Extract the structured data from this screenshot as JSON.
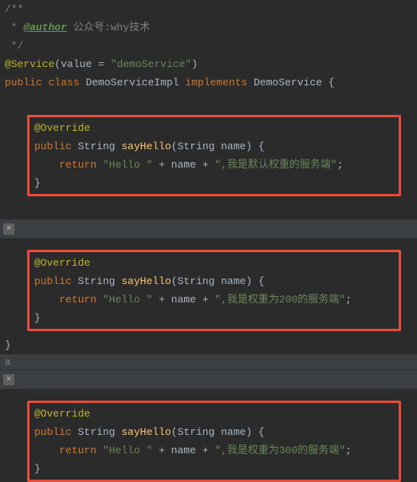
{
  "header": {
    "comment_open": "/**",
    "author_tag": "@author",
    "author_text": " 公众号:why技术",
    "comment_mid": " * ",
    "comment_close": " */"
  },
  "class_decl": {
    "annotation": "@Service",
    "anno_attr": "value",
    "anno_eq": " = ",
    "anno_val": "\"demoService\"",
    "kw_public": "public",
    "kw_class": "class",
    "class_name": "DemoServiceImpl",
    "kw_implements": "implements",
    "iface_name": "DemoService",
    "brace": "{"
  },
  "method1": {
    "override": "@Override",
    "kw_public": "public",
    "ret_type": "String",
    "name": "sayHello",
    "param_type": "String",
    "param_name": "name",
    "kw_return": "return",
    "str1": "\"Hello \"",
    "plus": " + ",
    "var": "name",
    "str2": "\",我是默认权重的服务端\"",
    "semi": ";",
    "brace_close": "}"
  },
  "method2": {
    "override": "@Override",
    "kw_public": "public",
    "ret_type": "String",
    "name": "sayHello",
    "param_type": "String",
    "param_name": "name",
    "kw_return": "return",
    "str1": "\"Hello \"",
    "plus": " + ",
    "var": "name",
    "str2": "\",我是权重为200的服务端\"",
    "semi": ";",
    "brace_close": "}"
  },
  "method3": {
    "override": "@Override",
    "kw_public": "public",
    "ret_type": "String",
    "name": "sayHello",
    "param_type": "String",
    "param_name": "name",
    "kw_return": "return",
    "str1": "\"Hello \"",
    "plus": " + ",
    "var": "name",
    "str2": "\",我是权重为300的服务端\"",
    "semi": ";",
    "brace_close": "}"
  },
  "closing_brace": "}",
  "tab_label": "a",
  "close_glyph": "×"
}
